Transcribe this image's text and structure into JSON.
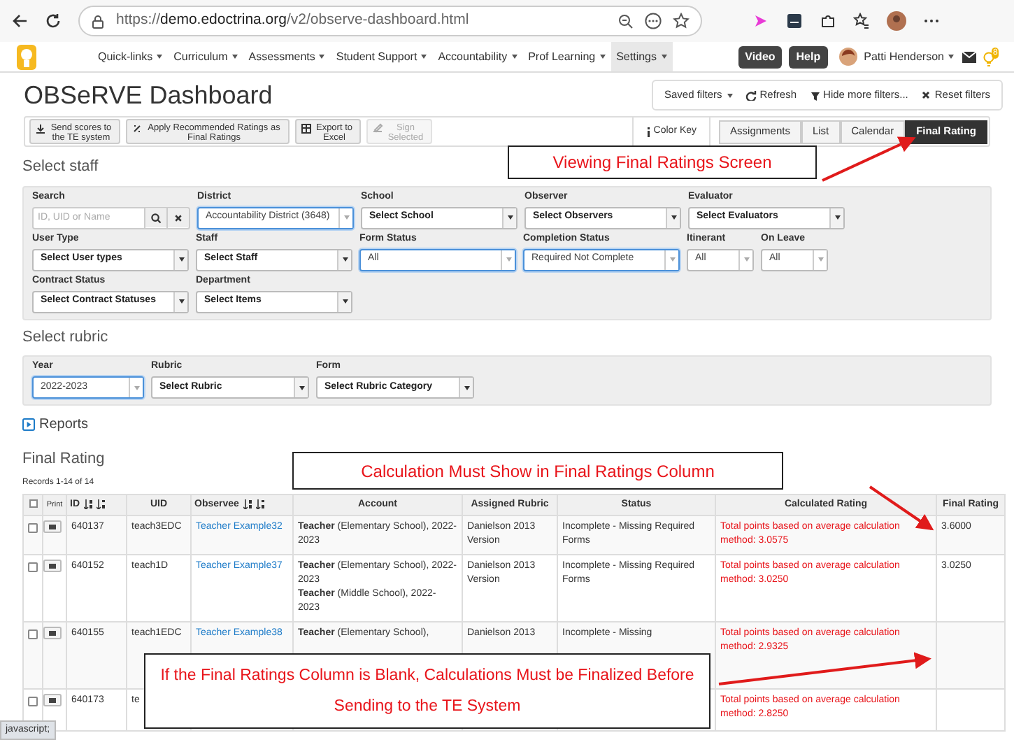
{
  "browser": {
    "url": "https://**demo.edoctrina.org**/v2/observe-dashboard.html"
  },
  "nav": {
    "items": [
      {
        "label": "Quick-links",
        "selected": false
      },
      {
        "label": "Curriculum",
        "selected": false
      },
      {
        "label": "Assessments",
        "selected": false
      },
      {
        "label": "Student Support",
        "selected": false
      },
      {
        "label": "Accountability",
        "selected": false
      },
      {
        "label": "Prof Learning",
        "selected": false
      },
      {
        "label": "Settings",
        "selected": true
      }
    ],
    "buttons": [
      "Video",
      "Help"
    ],
    "user": "Patti Henderson",
    "badge": "8"
  },
  "title": "OBSeRVE Dashboard",
  "filter_bar": [
    {
      "kind": "dropdown",
      "label": "Saved filters"
    },
    {
      "kind": "refresh",
      "label": "Refresh"
    },
    {
      "kind": "filter",
      "label": "Hide more filters..."
    },
    {
      "kind": "reset",
      "label": "Reset filters"
    }
  ],
  "actions": [
    {
      "kind": "download",
      "label": "Send scores to the TE system",
      "disabled": false
    },
    {
      "kind": "apply",
      "label": "Apply Recommended Ratings as Final Ratings",
      "disabled": false
    },
    {
      "kind": "export",
      "label": "Export to Excel",
      "disabled": false
    },
    {
      "kind": "sign",
      "label": "Sign Selected",
      "disabled": true
    }
  ],
  "color_key": "Color Key",
  "views": [
    {
      "label": "Assignments",
      "selected": false
    },
    {
      "label": "List",
      "selected": false
    },
    {
      "label": "Calendar",
      "selected": false
    },
    {
      "label": "Final Rating",
      "selected": true
    }
  ],
  "staff_section": {
    "title": "Select staff",
    "rows": [
      [
        {
          "kind": "search",
          "label": "Search",
          "placeholder": "ID, UID or Name"
        },
        {
          "kind": "select",
          "label": "District",
          "value": "Accountability District (3648)",
          "focused": true
        },
        {
          "kind": "select",
          "label": "School",
          "value": "Select School",
          "focused": false
        },
        {
          "kind": "select",
          "label": "Observer",
          "value": "Select Observers",
          "focused": false
        },
        {
          "kind": "select",
          "label": "Evaluator",
          "value": "Select Evaluators",
          "focused": false
        }
      ],
      [
        {
          "kind": "select",
          "label": "User Type",
          "value": "Select User types",
          "focused": false
        },
        {
          "kind": "select",
          "label": "Staff",
          "value": "Select Staff",
          "focused": false
        },
        {
          "kind": "select",
          "label": "Form Status",
          "value": "All",
          "focused": true
        },
        {
          "kind": "select",
          "label": "Completion Status",
          "value": "Required Not Complete",
          "focused": true
        },
        {
          "kind": "small",
          "label": "Itinerant",
          "value": "All",
          "focused": false
        },
        {
          "kind": "small",
          "label": "On Leave",
          "value": "All",
          "focused": false
        }
      ],
      [
        {
          "kind": "select",
          "label": "Contract Status",
          "value": "Select Contract Statuses",
          "focused": false
        },
        {
          "kind": "select",
          "label": "Department",
          "value": "Select Items",
          "focused": false
        }
      ]
    ]
  },
  "rubric_section": {
    "title": "Select rubric",
    "fields": [
      {
        "kind": "year",
        "label": "Year",
        "value": "2022-2023",
        "focused": true
      },
      {
        "kind": "select",
        "label": "Rubric",
        "value": "Select Rubric",
        "focused": false
      },
      {
        "kind": "select",
        "label": "Form",
        "value": "Select Rubric Category",
        "focused": false
      }
    ]
  },
  "reports": "Reports",
  "table_title": "Final Rating",
  "records": "Records 1-14 of 14",
  "table": {
    "all_checked": false,
    "columns": [
      "Print",
      "ID",
      "UID",
      "Observee",
      "Account",
      "Assigned Rubric",
      "Status",
      "Calculated Rating",
      "Final Rating"
    ],
    "rows": [
      {
        "checked": false,
        "id": "640137",
        "uid": "teach3EDC",
        "observee": "Teacher Example32",
        "account": [
          "**Teacher** (Elementary School), 2022-2023"
        ],
        "rubric": "Danielson 2013 Version",
        "status": "Incomplete - Missing Required Forms",
        "calculated": "Total points based on average calculation method: 3.0575",
        "final": "3.6000"
      },
      {
        "checked": false,
        "id": "640152",
        "uid": "teach1D",
        "observee": "Teacher Example37",
        "account": [
          "**Teacher** (Elementary School), 2022-2023",
          "**Teacher** (Middle School), 2022-2023"
        ],
        "rubric": "Danielson 2013 Version",
        "status": "Incomplete - Missing Required Forms",
        "calculated": "Total points based on average calculation method: 3.0250",
        "final": "3.0250"
      },
      {
        "checked": false,
        "id": "640155",
        "uid": "teach1EDC",
        "observee": "Teacher Example38",
        "account": [
          "**Teacher** (Elementary School),"
        ],
        "rubric": "Danielson 2013",
        "status": "Incomplete - Missing",
        "calculated": "Total points based on average calculation method: 2.9325"
      },
      {
        "checked": false,
        "id": "640173",
        "uid": "te",
        "calculated": "Total points based on average calculation method: 2.8250"
      }
    ]
  },
  "callouts": [
    "Viewing Final Ratings Screen",
    "Calculation Must Show in Final Ratings Column",
    "If the Final Ratings Column is Blank, Calculations Must be Finalized Before Sending to the TE System"
  ],
  "status_bar": "javascript;"
}
